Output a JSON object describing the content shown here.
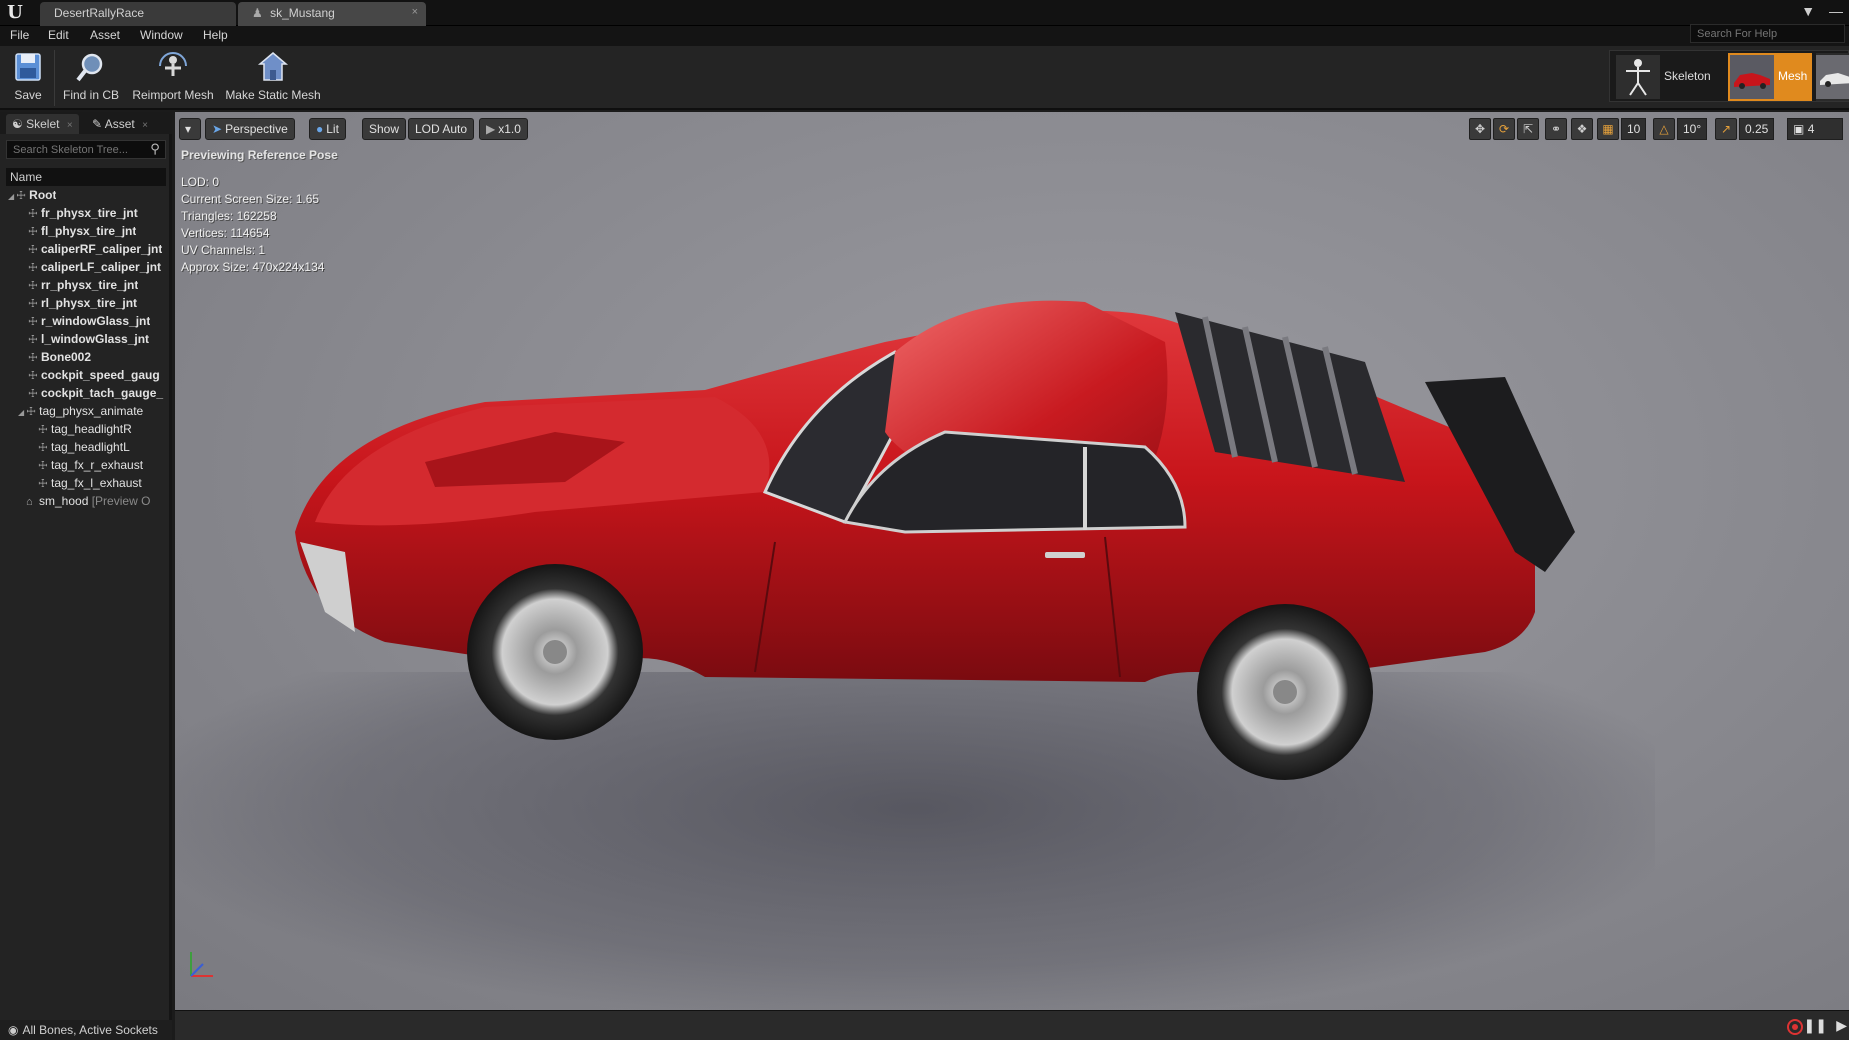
{
  "titlebar": {
    "tabs": [
      {
        "label": "DesertRallyRace"
      },
      {
        "label": "sk_Mustang",
        "close": "×"
      }
    ]
  },
  "menu": {
    "items": [
      "File",
      "Edit",
      "Asset",
      "Window",
      "Help"
    ],
    "help_search_placeholder": "Search For Help"
  },
  "toolbar": {
    "buttons": [
      {
        "label": "Save",
        "icon": "save-icon"
      },
      {
        "label": "Find in CB",
        "icon": "find-in-cb-icon"
      },
      {
        "label": "Reimport Mesh",
        "icon": "reimport-icon"
      },
      {
        "label": "Make Static Mesh",
        "icon": "static-mesh-icon"
      }
    ],
    "modes": {
      "skeleton": "Skeleton",
      "mesh": "Mesh"
    },
    "mesh_active_color": "#e08a1e"
  },
  "left_panel": {
    "tabs": [
      {
        "label": "Skelet"
      },
      {
        "label": "Asset"
      }
    ],
    "search_placeholder": "Search Skeleton Tree...",
    "column_header": "Name",
    "tree": [
      {
        "label": "Root"
      },
      {
        "label": "fr_physx_tire_jnt"
      },
      {
        "label": "fl_physx_tire_jnt"
      },
      {
        "label": "caliperRF_caliper_jnt"
      },
      {
        "label": "caliperLF_caliper_jnt"
      },
      {
        "label": "rr_physx_tire_jnt"
      },
      {
        "label": "rl_physx_tire_jnt"
      },
      {
        "label": "r_windowGlass_jnt"
      },
      {
        "label": "l_windowGlass_jnt"
      },
      {
        "label": "Bone002"
      },
      {
        "label": "cockpit_speed_gaug"
      },
      {
        "label": "cockpit_tach_gauge_"
      },
      {
        "label": "tag_physx_animate"
      },
      {
        "label": "tag_headlightR"
      },
      {
        "label": "tag_headlightL"
      },
      {
        "label": "tag_fx_r_exhaust"
      },
      {
        "label": "tag_fx_l_exhaust"
      },
      {
        "label": "sm_hood",
        "suffix": "[Preview O"
      }
    ],
    "footer": "All Bones, Active Sockets"
  },
  "viewport": {
    "perspective": "Perspective",
    "lit": "Lit",
    "show": "Show",
    "lod": "LOD Auto",
    "speed": "x1.0",
    "grid_snap": "10",
    "rot_snap": "10°",
    "scale_snap": "0.25",
    "camera_speed": "4",
    "preview_label": "Previewing Reference Pose",
    "stats": [
      "LOD: 0",
      "Current Screen Size: 1.65",
      "Triangles: 162258",
      "Vertices: 114654",
      "UV Channels: 1",
      "Approx Size: 470x224x134"
    ],
    "car_color": "#c8151b"
  }
}
